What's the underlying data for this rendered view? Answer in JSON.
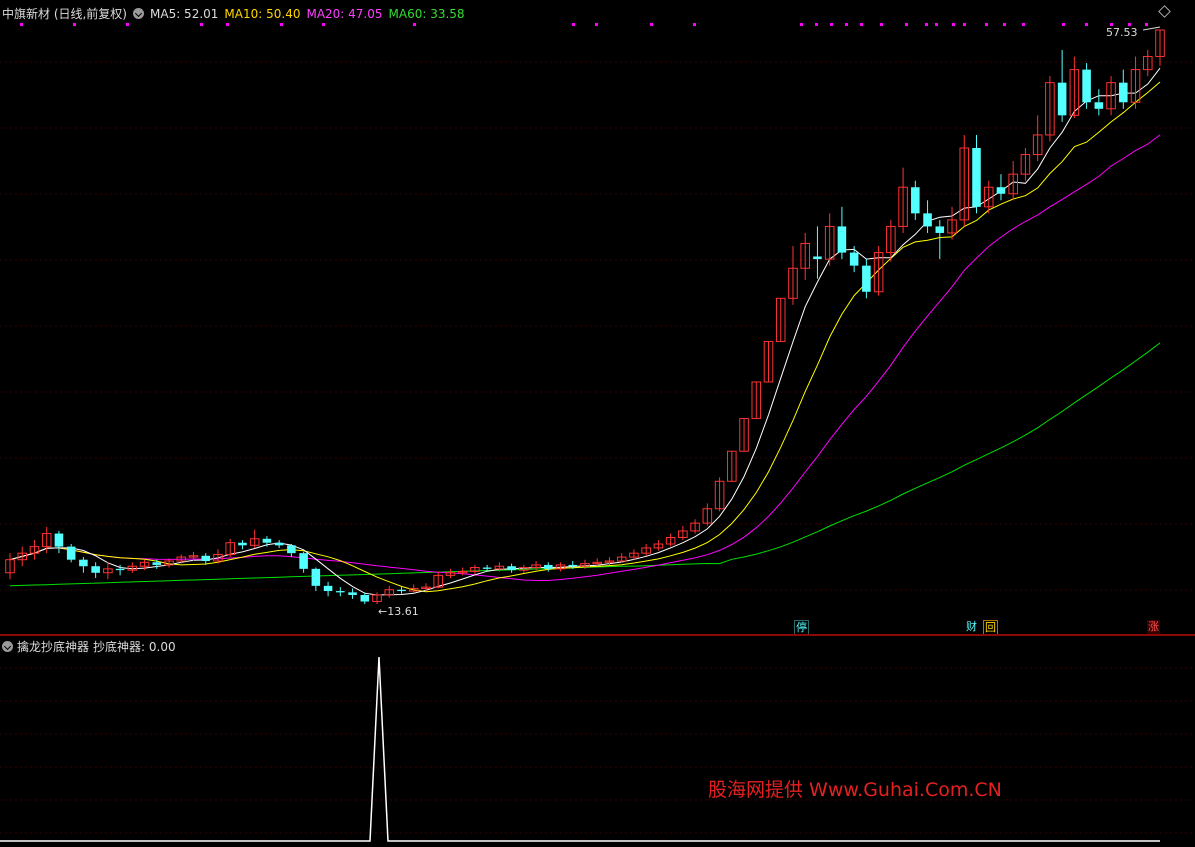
{
  "main": {
    "title": "中旗新材 (日线,前复权)",
    "ma5_label": "MA5: 52.01",
    "ma10_label": "MA10: 50.40",
    "ma20_label": "MA20: 47.05",
    "ma60_label": "MA60: 33.58",
    "high_label": "57.53",
    "low_label": "←13.61",
    "badges": {
      "ting": "停",
      "cai": "财",
      "hui": "回",
      "zhang": "涨"
    }
  },
  "sub": {
    "title": "擒龙抄底神器",
    "value_label": "抄底神器: 0.00"
  },
  "watermark": "股海网提供 Www.Guhai.Com.CN",
  "colors": {
    "up": "#ff3232",
    "down": "#54ffff",
    "ma5": "#ffffff",
    "ma10": "#ffff00",
    "ma20": "#ff00ff",
    "ma60": "#00e000",
    "grid": "#3a0000",
    "marker": "#ff00ff"
  },
  "chart_data": {
    "type": "candlestick",
    "ylim": [
      10,
      60
    ],
    "high": 57.53,
    "low": 13.61,
    "candles": [
      [
        16,
        17,
        15.5,
        17.5
      ],
      [
        17,
        17.5,
        16.5,
        18
      ],
      [
        17.5,
        18,
        17,
        18.5
      ],
      [
        18,
        19,
        17.5,
        19.5
      ],
      [
        19,
        18,
        17.5,
        19.2
      ],
      [
        18,
        17,
        16.8,
        18.2
      ],
      [
        17,
        16.5,
        16,
        17.2
      ],
      [
        16.5,
        16,
        15.6,
        16.8
      ],
      [
        16,
        16.3,
        15.5,
        16.8
      ],
      [
        16.3,
        16.2,
        15.8,
        16.6
      ],
      [
        16.2,
        16.5,
        16,
        16.8
      ],
      [
        16.5,
        16.8,
        16.2,
        17
      ],
      [
        16.8,
        16.6,
        16.3,
        17
      ],
      [
        16.6,
        16.9,
        16.4,
        17.1
      ],
      [
        16.9,
        17.2,
        16.7,
        17.4
      ],
      [
        17.2,
        17.3,
        16.9,
        17.6
      ],
      [
        17.3,
        16.9,
        16.6,
        17.5
      ],
      [
        16.9,
        17.4,
        16.7,
        17.8
      ],
      [
        17.4,
        18.3,
        17.2,
        18.6
      ],
      [
        18.3,
        18.1,
        17.8,
        18.5
      ],
      [
        18.1,
        18.6,
        17.9,
        19.3
      ],
      [
        18.6,
        18.3,
        18,
        18.8
      ],
      [
        18.3,
        18.1,
        17.9,
        18.5
      ],
      [
        18.1,
        17.5,
        17.2,
        18.2
      ],
      [
        17.5,
        16.3,
        16,
        17.6
      ],
      [
        16.3,
        15,
        14.6,
        16.4
      ],
      [
        15,
        14.6,
        14.2,
        15.3
      ],
      [
        14.6,
        14.5,
        14.2,
        14.9
      ],
      [
        14.5,
        14.3,
        14,
        14.8
      ],
      [
        14.3,
        13.8,
        13.6,
        14.5
      ],
      [
        13.8,
        14.3,
        13.61,
        14.5
      ],
      [
        14.3,
        14.7,
        14.1,
        15
      ],
      [
        14.7,
        14.6,
        14.4,
        14.9
      ],
      [
        14.6,
        14.8,
        14.5,
        15.1
      ],
      [
        14.8,
        14.9,
        14.6,
        15.2
      ],
      [
        14.9,
        15.8,
        14.8,
        16.1
      ],
      [
        15.8,
        16,
        15.6,
        16.3
      ],
      [
        16,
        16.1,
        15.8,
        16.4
      ],
      [
        16.1,
        16.4,
        15.9,
        16.6
      ],
      [
        16.4,
        16.3,
        16.1,
        16.6
      ],
      [
        16.3,
        16.5,
        16.1,
        16.8
      ],
      [
        16.5,
        16.2,
        16,
        16.7
      ],
      [
        16.2,
        16.4,
        16,
        16.6
      ],
      [
        16.4,
        16.6,
        16.2,
        16.9
      ],
      [
        16.6,
        16.3,
        16.1,
        16.8
      ],
      [
        16.3,
        16.6,
        16.1,
        16.8
      ],
      [
        16.6,
        16.5,
        16.3,
        16.9
      ],
      [
        16.5,
        16.7,
        16.3,
        17
      ],
      [
        16.7,
        16.8,
        16.5,
        17.1
      ],
      [
        16.8,
        16.9,
        16.6,
        17.2
      ],
      [
        16.9,
        17.2,
        16.8,
        17.5
      ],
      [
        17.2,
        17.5,
        17,
        17.8
      ],
      [
        17.5,
        17.9,
        17.3,
        18.2
      ],
      [
        17.9,
        18.2,
        17.7,
        18.5
      ],
      [
        18.2,
        18.7,
        18,
        19
      ],
      [
        18.7,
        19.2,
        18.5,
        19.6
      ],
      [
        19.2,
        19.8,
        19,
        20.1
      ],
      [
        19.8,
        20.9,
        19.6,
        21.3
      ],
      [
        20.9,
        23,
        20.7,
        23.3
      ],
      [
        23,
        25.3,
        23,
        25.3
      ],
      [
        25.3,
        27.8,
        25.3,
        27.8
      ],
      [
        27.8,
        30.6,
        27.8,
        30.6
      ],
      [
        30.6,
        33.7,
        30.6,
        33.7
      ],
      [
        33.7,
        37,
        33.7,
        37
      ],
      [
        37,
        39.3,
        36.5,
        41
      ],
      [
        39.3,
        41.2,
        38.4,
        42
      ],
      [
        40.2,
        40,
        38.5,
        42.5
      ],
      [
        40,
        42.5,
        39.5,
        43.5
      ],
      [
        42.5,
        40.5,
        40,
        44
      ],
      [
        40.5,
        39.5,
        39,
        41
      ],
      [
        39.5,
        37.5,
        37,
        40
      ],
      [
        37.5,
        40.5,
        37.2,
        41
      ],
      [
        40.5,
        42.5,
        39.8,
        43
      ],
      [
        42.5,
        45.5,
        42,
        47
      ],
      [
        45.5,
        43.5,
        43,
        46
      ],
      [
        43.5,
        42.5,
        42,
        44.5
      ],
      [
        42.5,
        42,
        40,
        43
      ],
      [
        42,
        43,
        41.5,
        44
      ],
      [
        43,
        48.5,
        42.5,
        49.5
      ],
      [
        48.5,
        44,
        43.5,
        49.5
      ],
      [
        44,
        45.5,
        43.5,
        46
      ],
      [
        45.5,
        45,
        44.5,
        46.5
      ],
      [
        45,
        46.5,
        44.5,
        47.5
      ],
      [
        46.5,
        48,
        46,
        48.5
      ],
      [
        48,
        49.5,
        47.5,
        51
      ],
      [
        49.5,
        53.5,
        49,
        54
      ],
      [
        53.5,
        51,
        50.5,
        56
      ],
      [
        51,
        54.5,
        50.8,
        55.5
      ],
      [
        54.5,
        52,
        51.5,
        55
      ],
      [
        52,
        51.5,
        51,
        53
      ],
      [
        51.5,
        53.5,
        51,
        54
      ],
      [
        53.5,
        52,
        51.5,
        54.5
      ],
      [
        52,
        54.5,
        51.5,
        55.5
      ],
      [
        54.5,
        55.5,
        54,
        56
      ],
      [
        55.5,
        57.53,
        54.8,
        57.53
      ]
    ]
  }
}
